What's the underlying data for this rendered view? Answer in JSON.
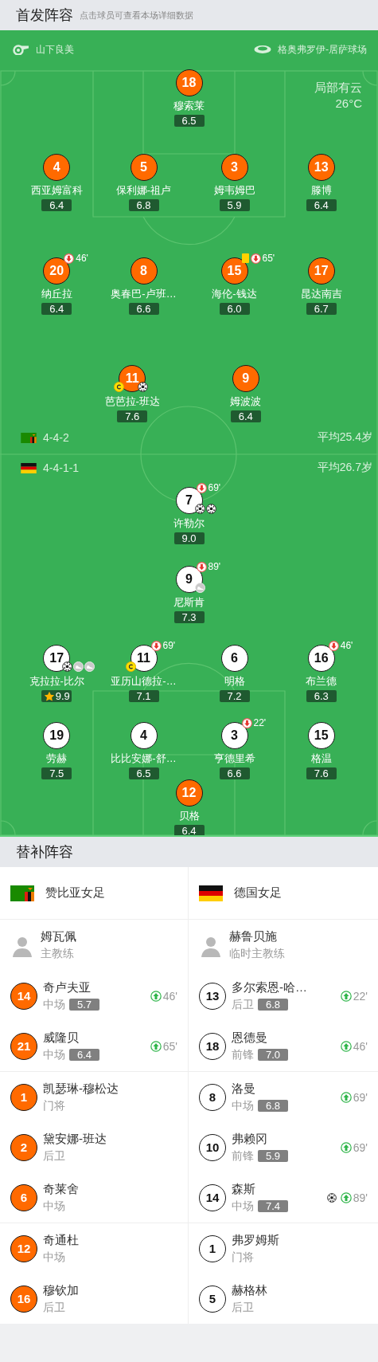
{
  "header": {
    "title": "首发阵容",
    "hint": "点击球员可查看本场详细数据"
  },
  "match_info": {
    "referee": "山下良美",
    "stadium": "格奥弗罗伊-居萨球场",
    "weather": "局部有云",
    "temperature": "26°C"
  },
  "teams": [
    {
      "kind": "zambia",
      "formation": "4-4-2",
      "avg_age": "平均25.4岁",
      "lines": [
        [
          {
            "number": "18",
            "name": "穆索莱",
            "rating": "6.5",
            "color": "#ff6a00",
            "captain": false,
            "yellow_card": false,
            "mvp": false
          }
        ],
        [
          {
            "number": "4",
            "name": "西亚姆富科",
            "rating": "6.4",
            "color": "#ff6a00",
            "captain": false,
            "yellow_card": false,
            "mvp": false
          },
          {
            "number": "5",
            "name": "保利娜-祖卢",
            "rating": "6.8",
            "color": "#ff6a00",
            "captain": false,
            "yellow_card": false,
            "mvp": false
          },
          {
            "number": "3",
            "name": "姆韦姆巴",
            "rating": "5.9",
            "color": "#ff6a00",
            "captain": false,
            "yellow_card": false,
            "mvp": false
          },
          {
            "number": "13",
            "name": "滕博",
            "rating": "6.4",
            "color": "#ff6a00",
            "captain": false,
            "yellow_card": false,
            "mvp": false
          }
        ],
        [
          {
            "number": "20",
            "name": "纳丘拉",
            "rating": "6.4",
            "color": "#ff6a00",
            "captain": false,
            "yellow_card": false,
            "mvp": false,
            "sub_off": "46'"
          },
          {
            "number": "8",
            "name": "奥春巴-卢班…",
            "rating": "6.6",
            "color": "#ff6a00",
            "captain": false,
            "yellow_card": false,
            "mvp": false
          },
          {
            "number": "15",
            "name": "海伦-钱达",
            "rating": "6.0",
            "color": "#ff6a00",
            "captain": false,
            "yellow_card": true,
            "mvp": false,
            "sub_off": "65'"
          },
          {
            "number": "17",
            "name": "昆达南吉",
            "rating": "6.7",
            "color": "#ff6a00",
            "captain": false,
            "yellow_card": false,
            "mvp": false
          }
        ],
        [
          {
            "number": "11",
            "name": "芭芭拉-班达",
            "rating": "7.6",
            "color": "#ff6a00",
            "captain": true,
            "yellow_card": false,
            "mvp": false,
            "events": [
              {
                "kind": "goal"
              }
            ]
          },
          {
            "number": "9",
            "name": "姆波波",
            "rating": "6.4",
            "color": "#ff6a00",
            "captain": false,
            "yellow_card": false,
            "mvp": false
          }
        ]
      ]
    },
    {
      "kind": "germany",
      "formation": "4-4-1-1",
      "avg_age": "平均26.7岁",
      "lines": [
        [
          {
            "number": "7",
            "name": "许勒尔",
            "rating": "9.0",
            "color": "#ffffff",
            "captain": false,
            "yellow_card": false,
            "mvp": false,
            "sub_off": "69'",
            "events": [
              {
                "kind": "goal"
              },
              {
                "kind": "goal"
              }
            ]
          }
        ],
        [
          {
            "number": "9",
            "name": "尼斯肯",
            "rating": "7.3",
            "color": "#ffffff",
            "captain": false,
            "yellow_card": false,
            "mvp": false,
            "sub_off": "89'",
            "events": [
              {
                "kind": "assist"
              }
            ]
          }
        ],
        [
          {
            "number": "17",
            "name": "克拉拉-比尔",
            "rating": "9.9",
            "color": "#ffffff",
            "captain": false,
            "yellow_card": false,
            "mvp": true,
            "events": [
              {
                "kind": "goal"
              },
              {
                "kind": "assist"
              },
              {
                "kind": "assist"
              }
            ]
          },
          {
            "number": "11",
            "name": "亚历山德拉-…",
            "rating": "7.1",
            "color": "#ffffff",
            "captain": true,
            "yellow_card": false,
            "mvp": false,
            "sub_off": "69'"
          },
          {
            "number": "6",
            "name": "明格",
            "rating": "7.2",
            "color": "#ffffff",
            "captain": false,
            "yellow_card": false,
            "mvp": false
          },
          {
            "number": "16",
            "name": "布兰德",
            "rating": "6.3",
            "color": "#ffffff",
            "captain": false,
            "yellow_card": false,
            "mvp": false,
            "sub_off": "46'"
          }
        ],
        [
          {
            "number": "19",
            "name": "劳赫",
            "rating": "7.5",
            "color": "#ffffff",
            "captain": false,
            "yellow_card": false,
            "mvp": false
          },
          {
            "number": "4",
            "name": "比比安娜-舒…",
            "rating": "6.5",
            "color": "#ffffff",
            "captain": false,
            "yellow_card": false,
            "mvp": false
          },
          {
            "number": "3",
            "name": "亨德里希",
            "rating": "6.6",
            "color": "#ffffff",
            "captain": false,
            "yellow_card": false,
            "mvp": false,
            "sub_off": "22'"
          },
          {
            "number": "15",
            "name": "格温",
            "rating": "7.6",
            "color": "#ffffff",
            "captain": false,
            "yellow_card": false,
            "mvp": false
          }
        ],
        [
          {
            "number": "12",
            "name": "贝格",
            "rating": "6.4",
            "color": "#ff6a00",
            "captain": false,
            "yellow_card": false,
            "mvp": false
          }
        ]
      ]
    }
  ],
  "substitutes": {
    "title": "替补阵容",
    "teams": [
      {
        "name": "赞比亚女足",
        "kind": "zambia"
      },
      {
        "name": "德国女足",
        "kind": "germany"
      }
    ],
    "sections": [
      [
        {
          "home": {
            "kind": "coach",
            "name": "姆瓦佩",
            "role": "主教练"
          },
          "away": {
            "kind": "coach",
            "name": "赫鲁贝施",
            "role": "临时主教练"
          }
        },
        {
          "home": {
            "kind": "player",
            "number": "14",
            "color": "#ff6a00",
            "name": "奇卢夫亚",
            "position": "中场",
            "rating": "5.7",
            "sub_in": "46'"
          },
          "away": {
            "kind": "player",
            "number": "13",
            "color": "#ffffff",
            "name": "多尔索恩-哈…",
            "position": "后卫",
            "rating": "6.8",
            "sub_in": "22'"
          }
        },
        {
          "home": {
            "kind": "player",
            "number": "21",
            "color": "#ff6a00",
            "name": "威隆贝",
            "position": "中场",
            "rating": "6.4",
            "sub_in": "65'"
          },
          "away": {
            "kind": "player",
            "number": "18",
            "color": "#ffffff",
            "name": "恩德曼",
            "position": "前锋",
            "rating": "7.0",
            "sub_in": "46'"
          }
        }
      ],
      [
        {
          "home": {
            "kind": "player",
            "number": "1",
            "color": "#ff6a00",
            "name": "凯瑟琳-穆松达",
            "position": "门将"
          },
          "away": {
            "kind": "player",
            "number": "8",
            "color": "#ffffff",
            "name": "洛曼",
            "position": "中场",
            "rating": "6.8",
            "sub_in": "69'"
          }
        },
        {
          "home": {
            "kind": "player",
            "number": "2",
            "color": "#ff6a00",
            "name": "黛安娜-班达",
            "position": "后卫"
          },
          "away": {
            "kind": "player",
            "number": "10",
            "color": "#ffffff",
            "name": "弗赖冈",
            "position": "前锋",
            "rating": "5.9",
            "sub_in": "69'"
          }
        },
        {
          "home": {
            "kind": "player",
            "number": "6",
            "color": "#ff6a00",
            "name": "奇莱舍",
            "position": "中场"
          },
          "away": {
            "kind": "player",
            "number": "14",
            "color": "#ffffff",
            "name": "森斯",
            "position": "中场",
            "rating": "7.4",
            "sub_in": "89'",
            "events": [
              {
                "kind": "goal"
              }
            ]
          }
        }
      ],
      [
        {
          "home": {
            "kind": "player",
            "number": "12",
            "color": "#ff6a00",
            "name": "奇通杜",
            "position": "中场"
          },
          "away": {
            "kind": "player",
            "number": "1",
            "color": "#ffffff",
            "name": "弗罗姆斯",
            "position": "门将"
          }
        },
        {
          "home": {
            "kind": "player",
            "number": "16",
            "color": "#ff6a00",
            "name": "穆钦加",
            "position": "后卫"
          },
          "away": {
            "kind": "player",
            "number": "5",
            "color": "#ffffff",
            "name": "赫格林",
            "position": "后卫"
          }
        }
      ]
    ]
  }
}
